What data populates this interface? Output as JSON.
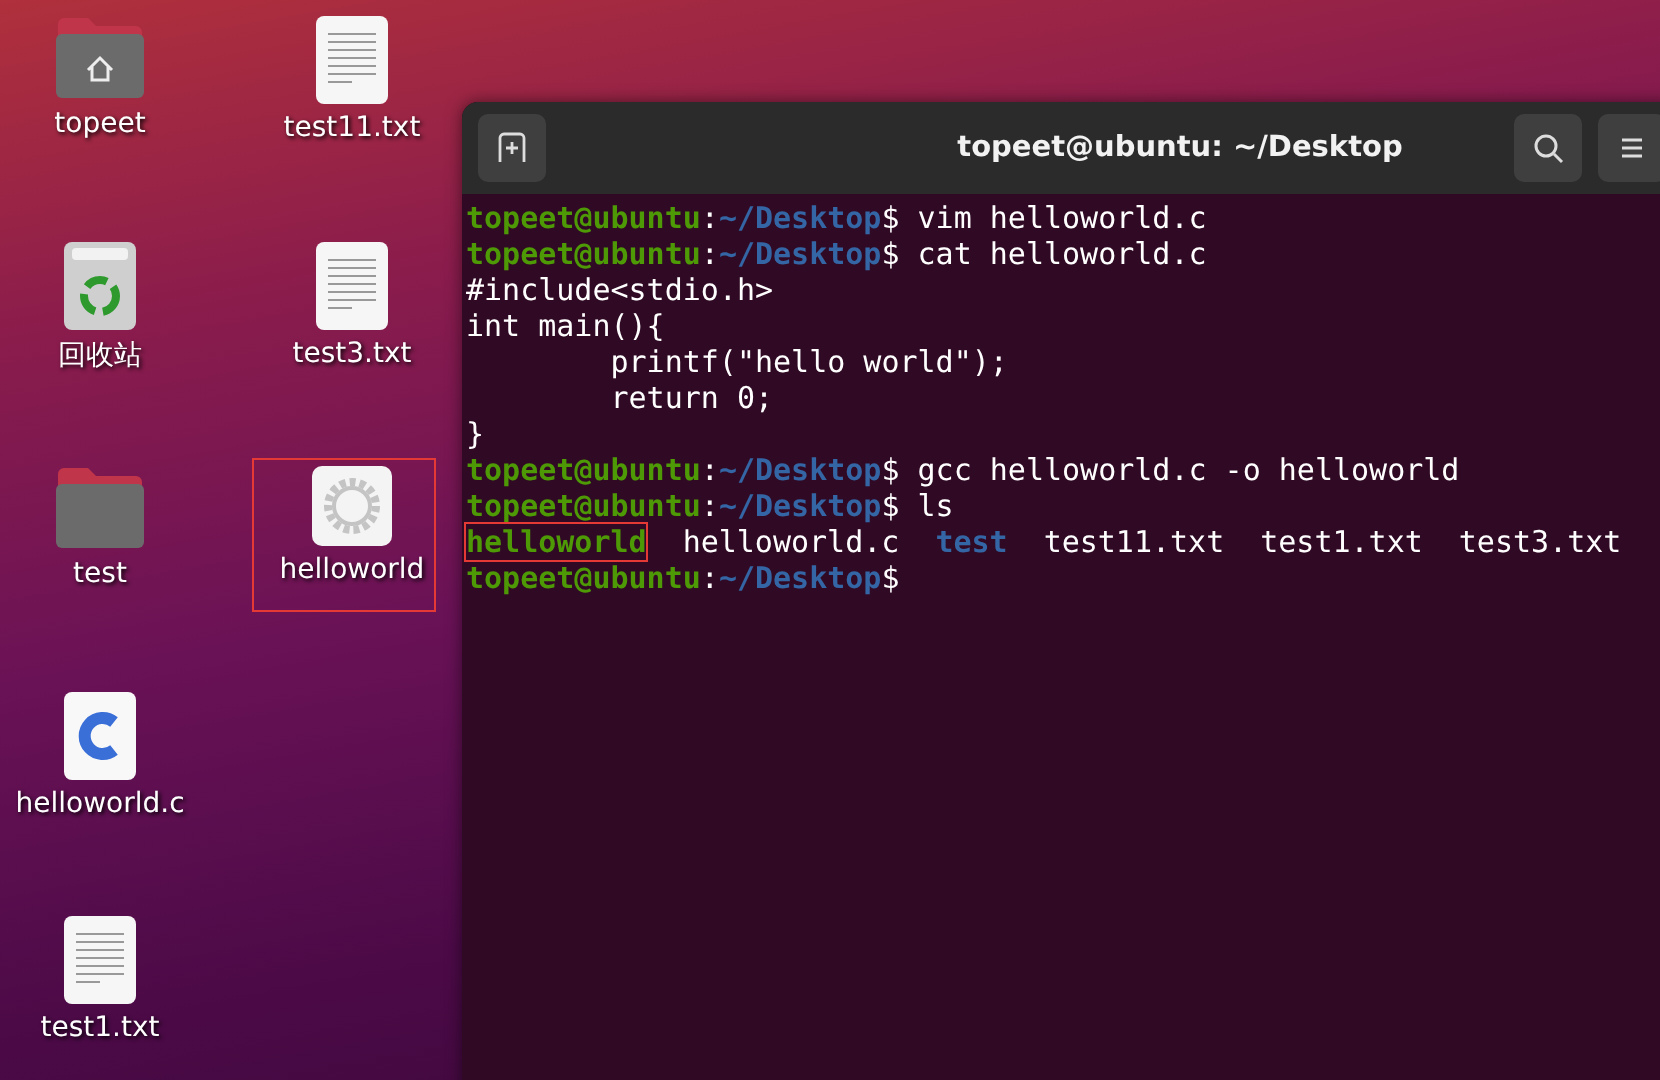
{
  "desktop_columns": [
    {
      "icons": [
        {
          "label": "topeet",
          "kind": "home-folder",
          "highlighted": false
        },
        {
          "label": "回收站",
          "kind": "trash",
          "highlighted": false
        },
        {
          "label": "test",
          "kind": "folder",
          "highlighted": false
        },
        {
          "label": "helloworld.c",
          "kind": "c-source",
          "highlighted": false
        },
        {
          "label": "test1.txt",
          "kind": "text",
          "highlighted": false
        }
      ]
    },
    {
      "icons": [
        {
          "label": "test11.txt",
          "kind": "text",
          "highlighted": false
        },
        {
          "label": "test3.txt",
          "kind": "text",
          "highlighted": false
        },
        {
          "label": "helloworld",
          "kind": "executable",
          "highlighted": true
        }
      ]
    }
  ],
  "terminal": {
    "title": "topeet@ubuntu: ~/Desktop",
    "lines": [
      {
        "kind": "prompt",
        "user": "topeet@ubuntu",
        "separator": ":",
        "path": "~/Desktop",
        "command": "$ vim helloworld.c"
      },
      {
        "kind": "prompt",
        "user": "topeet@ubuntu",
        "separator": ":",
        "path": "~/Desktop",
        "command": "$ cat helloworld.c"
      },
      {
        "kind": "output",
        "text": "#include<stdio.h>"
      },
      {
        "kind": "output",
        "text": "int main(){"
      },
      {
        "kind": "output",
        "text": "\tprintf(\"hello world\");"
      },
      {
        "kind": "output",
        "text": "\treturn 0;"
      },
      {
        "kind": "output",
        "text": "}"
      },
      {
        "kind": "prompt",
        "user": "topeet@ubuntu",
        "separator": ":",
        "path": "~/Desktop",
        "command": "$ gcc helloworld.c -o helloworld"
      },
      {
        "kind": "prompt",
        "user": "topeet@ubuntu",
        "separator": ":",
        "path": "~/Desktop",
        "command": "$ ls"
      },
      {
        "kind": "listing",
        "entries": [
          {
            "name": "helloworld",
            "kind": "executable",
            "highlighted": true
          },
          {
            "name": "helloworld.c",
            "kind": "file",
            "highlighted": false
          },
          {
            "name": "test",
            "kind": "directory",
            "highlighted": false
          },
          {
            "name": "test11.txt",
            "kind": "file",
            "highlighted": false
          },
          {
            "name": "test1.txt",
            "kind": "file",
            "highlighted": false
          },
          {
            "name": "test3.txt",
            "kind": "file",
            "highlighted": false
          }
        ]
      },
      {
        "kind": "prompt",
        "user": "topeet@ubuntu",
        "separator": ":",
        "path": "~/Desktop",
        "command": "$"
      }
    ]
  }
}
